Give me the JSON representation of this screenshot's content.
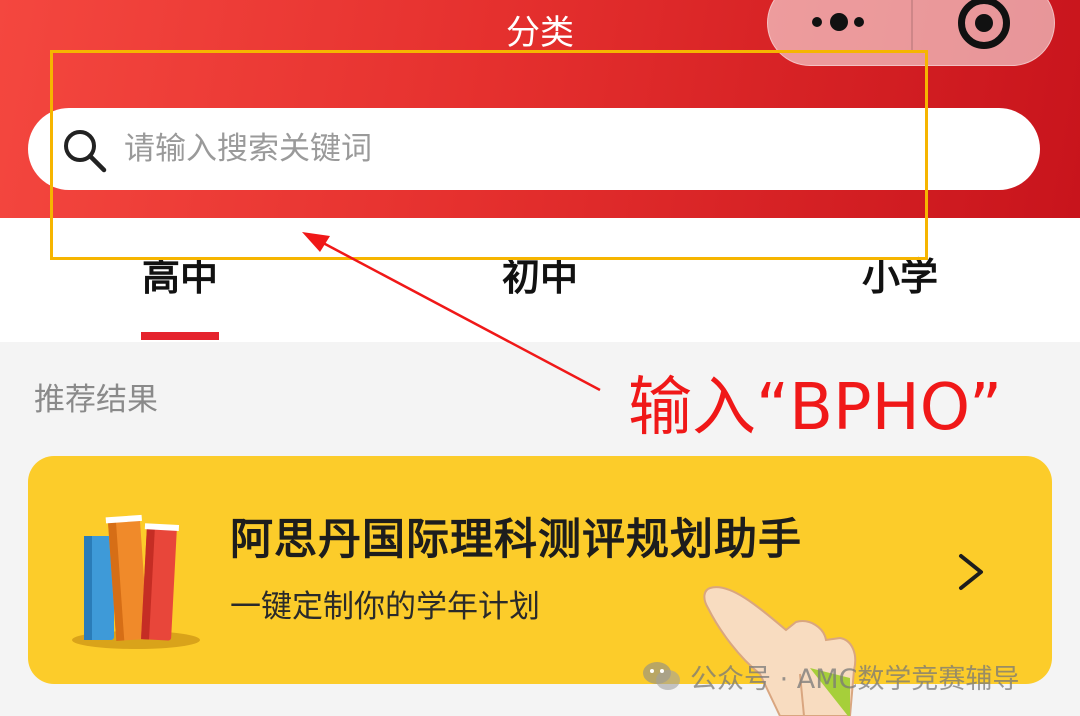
{
  "header": {
    "title": "分类",
    "search_placeholder": "请输入搜索关键词",
    "more_icon": "more-dots-icon",
    "close_icon": "target-close-icon"
  },
  "tabs": [
    {
      "label": "高中",
      "active": true
    },
    {
      "label": "初中",
      "active": false
    },
    {
      "label": "小学",
      "active": false
    }
  ],
  "section": {
    "label": "推荐结果"
  },
  "card": {
    "title": "阿思丹国际理科测评规划助手",
    "subtitle": "一键定制你的学年计划",
    "illustration": "books-icon",
    "action_icon": "chevron-right-icon"
  },
  "annotation": {
    "text": "输入“BPHO”",
    "color": "#f01818",
    "box_color": "#f6b500"
  },
  "watermark": {
    "text": "公众号 · AMC数学竞赛辅导",
    "icon": "wechat-icon"
  },
  "colors": {
    "header_red": "#e5302e",
    "tab_indicator": "#e5232d",
    "card_yellow": "#fccc2a"
  }
}
